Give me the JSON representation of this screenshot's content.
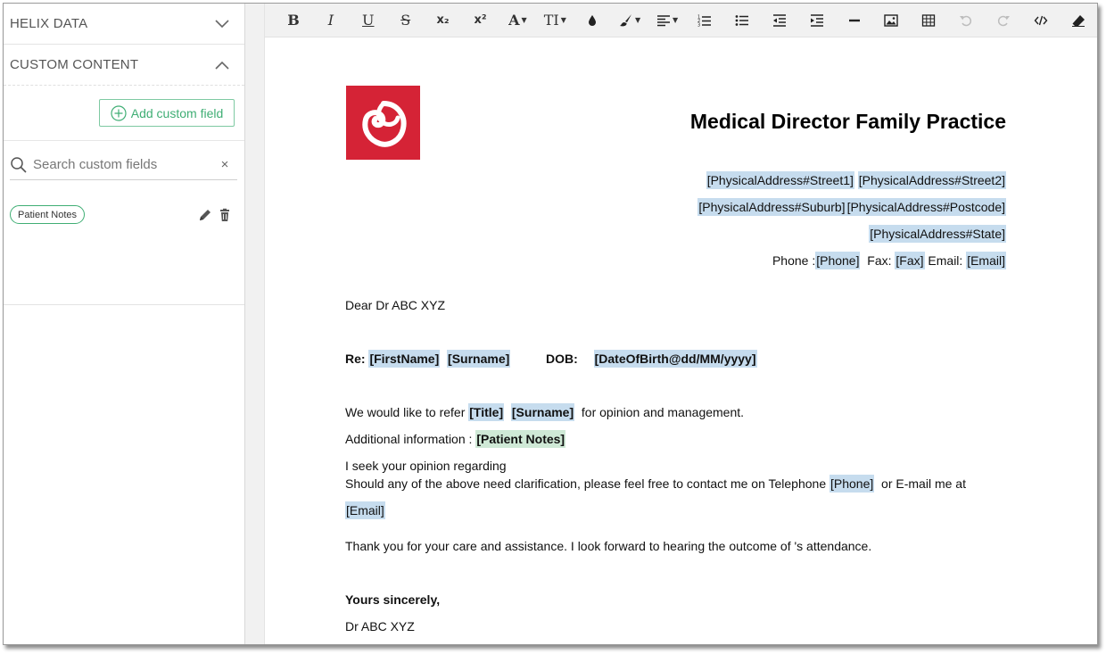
{
  "sidebar": {
    "helix_data_label": "HELIX DATA",
    "custom_content_label": "CUSTOM CONTENT",
    "add_custom_field_label": "Add custom field",
    "search_placeholder": "Search custom fields",
    "clear_symbol": "×",
    "custom_fields": [
      {
        "label": "Patient Notes"
      }
    ]
  },
  "toolbar": {
    "buttons": [
      {
        "name": "bold",
        "glyph": "B"
      },
      {
        "name": "italic",
        "glyph": "I"
      },
      {
        "name": "underline",
        "glyph": "U"
      },
      {
        "name": "strikethrough",
        "glyph": "S"
      },
      {
        "name": "subscript",
        "glyph": "x₂"
      },
      {
        "name": "superscript",
        "glyph": "x²"
      },
      {
        "name": "font-family",
        "glyph": "A"
      },
      {
        "name": "font-size",
        "glyph": "TI"
      },
      {
        "name": "text-color",
        "glyph": "drop-icon"
      },
      {
        "name": "highlight-color",
        "glyph": "brush-icon"
      },
      {
        "name": "align",
        "glyph": "align-icon"
      },
      {
        "name": "ordered-list",
        "glyph": "ol-icon"
      },
      {
        "name": "unordered-list",
        "glyph": "ul-icon"
      },
      {
        "name": "outdent",
        "glyph": "outdent-icon"
      },
      {
        "name": "indent",
        "glyph": "indent-icon"
      },
      {
        "name": "horizontal-rule",
        "glyph": "hr-icon"
      },
      {
        "name": "insert-image",
        "glyph": "image-icon"
      },
      {
        "name": "insert-table",
        "glyph": "table-icon"
      },
      {
        "name": "undo",
        "glyph": "undo-icon"
      },
      {
        "name": "redo",
        "glyph": "redo-icon"
      },
      {
        "name": "code-view",
        "glyph": "code-icon"
      },
      {
        "name": "clear-format",
        "glyph": "eraser-icon"
      }
    ]
  },
  "document": {
    "practice_name": "Medical Director Family Practice",
    "address_line1": [
      "[PhysicalAddress#Street1]",
      "[PhysicalAddress#Street2]"
    ],
    "address_line2": [
      "[PhysicalAddress#Suburb]",
      "[PhysicalAddress#Postcode]"
    ],
    "address_line3": "[PhysicalAddress#State]",
    "contact": {
      "phone_label": "Phone :",
      "phone_field": "[Phone]",
      "fax_label": "Fax:",
      "fax_field": "[Fax]",
      "email_label": "Email:",
      "email_field": "[Email]"
    },
    "salutation": "Dear Dr ABC XYZ",
    "re_label": "Re:",
    "re_firstname": "[FirstName]",
    "re_surname": "[Surname]",
    "dob_label": "DOB:",
    "dob_field": "[DateOfBirth@dd/MM/yyyy]",
    "refer_prefix": "We would like to refer",
    "refer_title": "[Title]",
    "refer_surname": "[Surname]",
    "refer_suffix": "for opinion and management.",
    "additional_label": "Additional information :",
    "additional_field": "[Patient Notes]",
    "opinion_line": "I seek your opinion regarding",
    "clarification_text": "Should any of the above need clarification, please feel free to contact me on Telephone",
    "clarification_phone": "[Phone]",
    "clarification_or": "or E-mail me at",
    "clarification_email": "[Email]",
    "thanks_line": "Thank you for your care and assistance. I look forward to hearing the outcome of 's attendance.",
    "closing": "Yours sincerely,",
    "signature": "Dr ABC XYZ"
  },
  "colors": {
    "accent_green": "#3fae74",
    "logo_red": "#d52336",
    "placeholder_highlight": "#c6dcee",
    "custom_field_highlight": "#cfe9d6"
  }
}
